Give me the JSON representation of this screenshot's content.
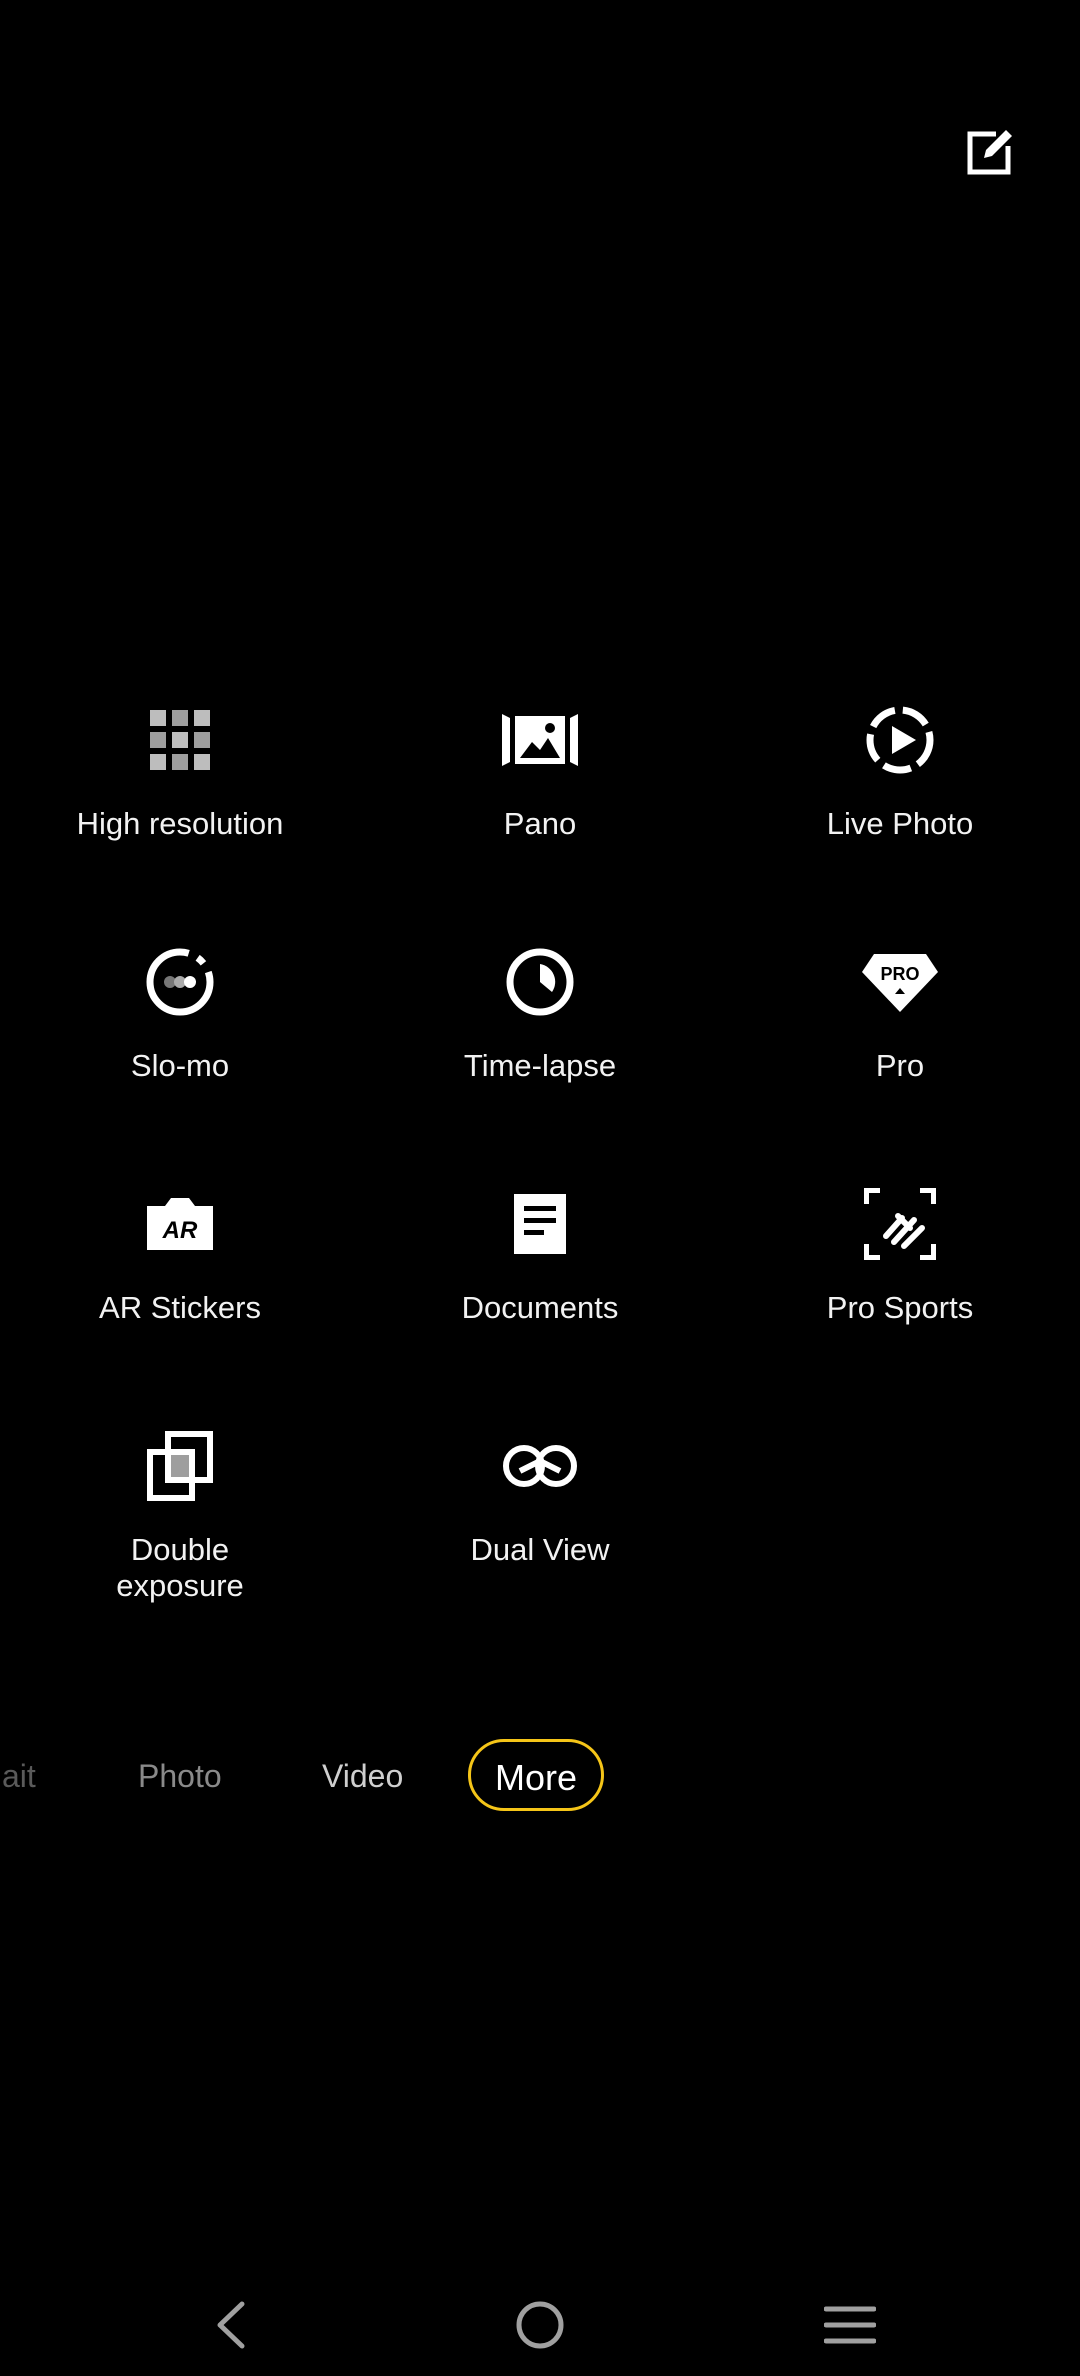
{
  "modes_grid": [
    {
      "id": "high-resolution",
      "label": "High resolution",
      "icon": "grid-dots-icon"
    },
    {
      "id": "pano",
      "label": "Pano",
      "icon": "panorama-icon"
    },
    {
      "id": "live-photo",
      "label": "Live Photo",
      "icon": "live-photo-icon"
    },
    {
      "id": "slo-mo",
      "label": "Slo-mo",
      "icon": "slow-motion-icon"
    },
    {
      "id": "time-lapse",
      "label": "Time-lapse",
      "icon": "clock-icon"
    },
    {
      "id": "pro",
      "label": "Pro",
      "icon": "pro-badge-icon"
    },
    {
      "id": "ar-stickers",
      "label": "AR Stickers",
      "icon": "ar-camera-icon"
    },
    {
      "id": "documents",
      "label": "Documents",
      "icon": "document-icon"
    },
    {
      "id": "pro-sports",
      "label": "Pro Sports",
      "icon": "sports-focus-icon"
    },
    {
      "id": "double-exposure",
      "label": "Double\nexposure",
      "icon": "double-exposure-icon"
    },
    {
      "id": "dual-view",
      "label": "Dual View",
      "icon": "dual-view-icon"
    }
  ],
  "mode_bar": {
    "items": [
      {
        "label": "ait",
        "state": "faint"
      },
      {
        "label": "Photo",
        "state": "faded"
      },
      {
        "label": "Video",
        "state": "normal"
      },
      {
        "label": "More",
        "state": "active"
      }
    ],
    "active_color": "#f5c518"
  },
  "top_bar": {
    "edit_icon": "edit-icon"
  },
  "nav_bar": {
    "back_icon": "back-icon",
    "home_icon": "home-icon",
    "menu_icon": "menu-icon"
  }
}
